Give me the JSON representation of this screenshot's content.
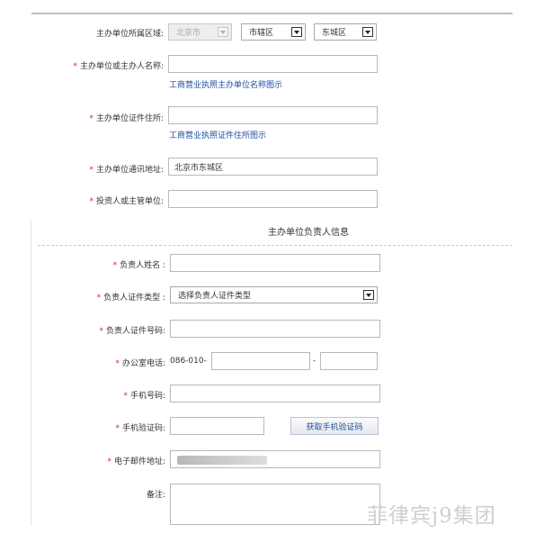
{
  "form": {
    "region_label": "主办单位所属区域:",
    "region_select_1": "北京市",
    "region_select_2": "市辖区",
    "region_select_3": "东城区",
    "org_name_label": "主办单位或主办人名称:",
    "org_name_value": "",
    "org_name_link": "工商营业执照主办单位名称图示",
    "org_address_label": "主办单位证件住所:",
    "org_address_value": "",
    "org_address_link": "工商营业执照证件住所图示",
    "mail_address_label": "主办单位通讯地址:",
    "mail_address_value": "北京市东城区",
    "investor_label": "投资人或主管单位:",
    "investor_value": ""
  },
  "section": {
    "title": "主办单位负责人信息"
  },
  "person": {
    "name_label": "负责人姓名 :",
    "name_value": "",
    "id_type_label": "负责人证件类型 :",
    "id_type_value": "选择负责人证件类型",
    "id_number_label": "负责人证件号码:",
    "id_number_value": "",
    "office_phone_label": "办公室电话:",
    "office_phone_prefix": "086-010-",
    "office_phone_value": "",
    "office_phone_separator": "-",
    "office_phone_ext": "",
    "mobile_label": "手机号码:",
    "mobile_value": "",
    "sms_code_label": "手机验证码:",
    "sms_code_value": "",
    "sms_code_button": "获取手机验证码",
    "email_label": "电子邮件地址:",
    "remark_label": "备注:",
    "remark_value": ""
  },
  "required_mark": "*",
  "watermark": "菲律宾j9集团"
}
